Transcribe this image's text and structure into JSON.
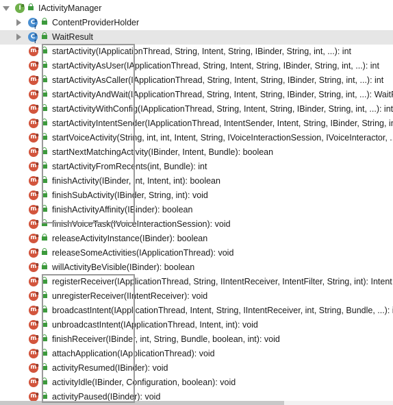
{
  "root": {
    "label": "IActivityManager",
    "icon": "interface-icon",
    "expanded": true
  },
  "classes": [
    {
      "label": "ContentProviderHolder",
      "icon": "static-final-class-icon"
    },
    {
      "label": "WaitResult",
      "icon": "static-final-class-icon",
      "selected": true
    }
  ],
  "methods": [
    "startActivity(IApplicationThread, String, Intent, String, IBinder, String, int, ...): int",
    "startActivityAsUser(IApplicationThread, String, Intent, String, IBinder, String, int, ...): int",
    "startActivityAsCaller(IApplicationThread, String, Intent, String, IBinder, String, int, ...): int",
    "startActivityAndWait(IApplicationThread, String, Intent, String, IBinder, String, int, ...): WaitResult",
    "startActivityWithConfig(IApplicationThread, String, Intent, String, IBinder, String, int, ...): int",
    "startActivityIntentSender(IApplicationThread, IntentSender, Intent, String, IBinder, String, int, ...): int",
    "startVoiceActivity(String, int, int, Intent, String, IVoiceInteractionSession, IVoiceInteractor, ...): int",
    "startNextMatchingActivity(IBinder, Intent, Bundle): boolean",
    "startActivityFromRecents(int, Bundle): int",
    "finishActivity(IBinder, int, Intent, int): boolean",
    "finishSubActivity(IBinder, String, int): void",
    "finishActivityAffinity(IBinder): boolean",
    "finishVoiceTask(IVoiceInteractionSession): void",
    "releaseActivityInstance(IBinder): boolean",
    "releaseSomeActivities(IApplicationThread): void",
    "willActivityBeVisible(IBinder): boolean",
    "registerReceiver(IApplicationThread, String, IIntentReceiver, IntentFilter, String, int): Intent",
    "unregisterReceiver(IIntentReceiver): void",
    "broadcastIntent(IApplicationThread, Intent, String, IIntentReceiver, int, String, Bundle, ...): int",
    "unbroadcastIntent(IApplicationThread, Intent, int): void",
    "finishReceiver(IBinder, int, String, Bundle, boolean, int): void",
    "attachApplication(IApplicationThread): void",
    "activityResumed(IBinder): void",
    "activityIdle(IBinder, Configuration, boolean): void",
    "activityPaused(IBinder): void"
  ]
}
